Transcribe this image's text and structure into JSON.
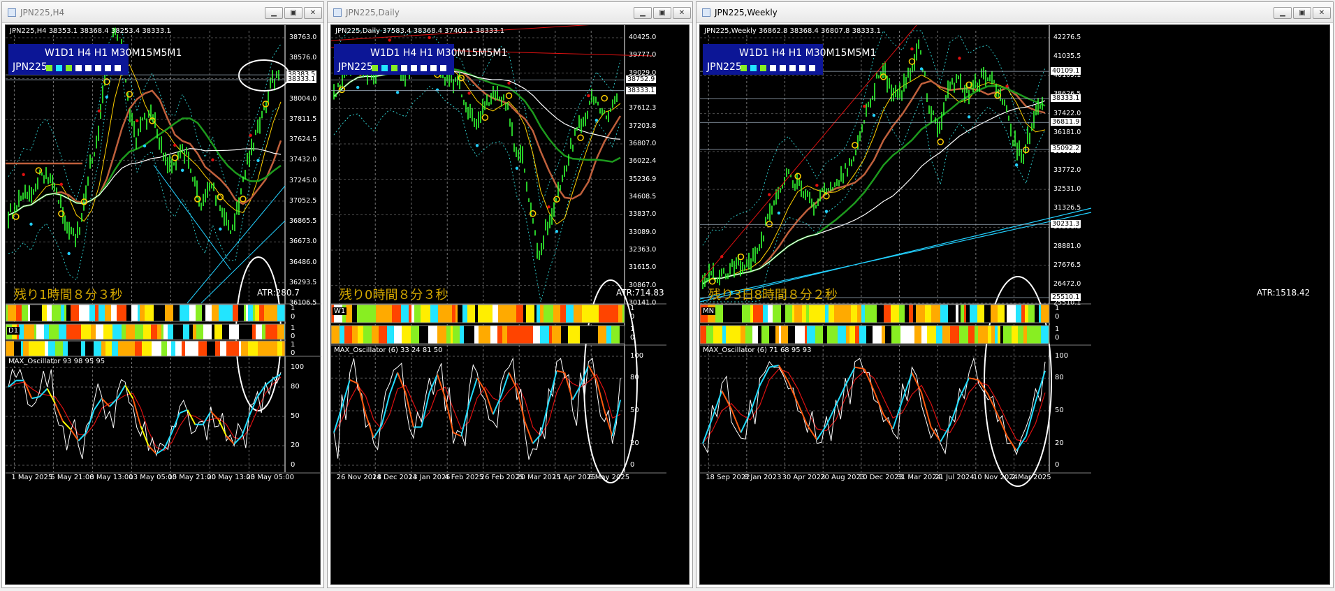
{
  "colors": {
    "candle": "#33ff33",
    "ma_white": "#ffffff",
    "ma_brown": "#c0603c",
    "ma_green": "#1d9a1d",
    "ma_yellow": "#ffd000",
    "band_cyan": "#2ec9c9",
    "trend_cyan": "#22d0ff",
    "trend_red": "#e01010",
    "osc_white": "#ffffff",
    "osc_red": "#dd1111",
    "osc_orange": "#ff5a10",
    "osc_cyan": "#22ddff",
    "osc_yellow": "#ffff00",
    "bar_white": "#ffffff",
    "bar_cyan": "#22e5ff",
    "bar_green": "#88ee22",
    "bar_red": "#ff4400",
    "bar_orange": "#ffaa00",
    "bar_yellow": "#ffee00"
  },
  "infobox": {
    "timeframes": "W1D1 H4 H1 M30M15M5M1",
    "symbol": "JPN225",
    "dot_colors": [
      "#88ee22",
      "#22e5ff",
      "#88ee22",
      "#ffffff",
      "#ffffff",
      "#ffffff",
      "#ffffff",
      "#ffffff"
    ]
  },
  "windows": [
    {
      "title": "JPN225,H4",
      "panel_title": "JPN225,H4  38353.1 38368.4 38253.4 38333.1",
      "remaining": "残り1時間８分３秒",
      "atr": "ATR:280.7",
      "oscillator": "MAX_Oscillator 93 98 95 95",
      "strip_labels": [
        "",
        "D1",
        ""
      ],
      "chart_data": {
        "type": "line",
        "title": "",
        "price_ticks": [
          "38763.0",
          "38576.0",
          "38191.0",
          "38004.0",
          "37811.5",
          "37624.5",
          "37432.0",
          "37245.0",
          "37052.5",
          "36865.5",
          "36673.0",
          "36486.0",
          "36293.5",
          "36106.5"
        ],
        "price_tags": [
          "38383.5",
          "38333.1"
        ],
        "x_labels": [
          "1 May 2025",
          "5 May 21:00",
          "8 May 13:00",
          "13 May 05:00",
          "15 May 21:00",
          "20 May 13:00",
          "23 May 05:00"
        ],
        "osc_levels": [
          "100",
          "80",
          "50",
          "20",
          "0"
        ],
        "ylim": [
          36106.5,
          38763.0
        ],
        "series": [
          {
            "values": [
              36950,
              37020,
              37150,
              37100,
              37320,
              37400,
              37250,
              37050,
              36800,
              36700,
              37000,
              37500,
              37800,
              38400,
              38800,
              38650,
              38100,
              37700,
              37900,
              38000,
              37750,
              37500,
              37450,
              37650,
              37500,
              37200,
              37050,
              37300,
              37050,
              36850,
              36800,
              37200,
              37550,
              37750,
              38000,
              38300,
              38380
            ]
          }
        ],
        "osc": [
          {
            "values": [
              80,
              90,
              85,
              60,
              75,
              80,
              55,
              40,
              35,
              20,
              40,
              65,
              70,
              55,
              75,
              85,
              60,
              30,
              15,
              10,
              20,
              40,
              60,
              55,
              35,
              45,
              60,
              40,
              25,
              20,
              35,
              60,
              75,
              85,
              90,
              95
            ]
          }
        ]
      }
    },
    {
      "title": "JPN225,Daily",
      "panel_title": "JPN225,Daily  37583.4 38368.4 37403.1 38333.1",
      "remaining": "残り0時間８分３秒",
      "atr": "ATR:714.83",
      "oscillator": "MAX_Oscillator (6) 33 24 81 50",
      "strip_labels": [
        "W1",
        ""
      ],
      "chart_data": {
        "type": "line",
        "title": "",
        "price_ticks": [
          "40425.0",
          "39777.0",
          "39029.0",
          "38588.5",
          "37612.3",
          "37203.8",
          "36807.0",
          "36022.4",
          "35236.9",
          "34608.5",
          "33837.0",
          "33089.0",
          "32363.0",
          "31615.0",
          "30867.0",
          "30141.0"
        ],
        "price_tags": [
          "38752.9",
          "38333.1"
        ],
        "x_labels": [
          "26 Nov 2024",
          "18 Dec 2024",
          "13 Jan 2025",
          "4 Feb 2025",
          "26 Feb 2025",
          "20 Mar 2025",
          "11 Apr 2025",
          "6 May 2025"
        ],
        "osc_levels": [
          "100",
          "80",
          "50",
          "20",
          "0"
        ],
        "ylim": [
          30141.0,
          40425.0
        ],
        "series": [
          {
            "values": [
              38100,
              38700,
              39200,
              39400,
              39100,
              38800,
              39300,
              39500,
              39200,
              38900,
              39300,
              39400,
              39600,
              39300,
              38900,
              38700,
              38500,
              37400,
              37100,
              37600,
              38000,
              38200,
              37800,
              36200,
              35600,
              33800,
              31800,
              32900,
              33700,
              34700,
              35900,
              36800,
              37300,
              38100,
              37700,
              37200,
              38300
            ]
          }
        ],
        "osc": [
          {
            "values": [
              30,
              65,
              85,
              70,
              35,
              20,
              45,
              75,
              90,
              55,
              25,
              40,
              80,
              85,
              50,
              20,
              30,
              70,
              85,
              60,
              40,
              75,
              90,
              60,
              30,
              15,
              35,
              70,
              95,
              80,
              50,
              85,
              95,
              70,
              40,
              20,
              80
            ]
          }
        ]
      }
    },
    {
      "title": "JPN225,Weekly",
      "panel_title": "JPN225,Weekly  36862.8 38368.4 36807.8 38333.1",
      "remaining": "残り3日8時間８分２秒",
      "atr": "ATR:1518.42",
      "oscillator": "MAX_Oscillator (6) 71 68 95 93",
      "strip_labels": [
        "MN",
        ""
      ],
      "chart_data": {
        "type": "line",
        "title": "",
        "price_ticks": [
          "42276.5",
          "41035.5",
          "40109.1",
          "38626.5",
          "37422.0",
          "36181.0",
          "35092.2",
          "33772.0",
          "32531.0",
          "31326.5",
          "30231.3",
          "28881.0",
          "27676.5",
          "26472.0",
          "25510.1"
        ],
        "price_tags": [
          "40109.1",
          "38333.1",
          "36811.9",
          "35092.2",
          "30231.3",
          "25510.1"
        ],
        "x_labels": [
          "18 Sep 2022",
          "8 Jan 2023",
          "30 Apr 2023",
          "20 Aug 2023",
          "10 Dec 2023",
          "31 Mar 2024",
          "21 Jul 2024",
          "10 Nov 2024",
          "2 Mar 2025"
        ],
        "osc_levels": [
          "100",
          "80",
          "50",
          "20",
          "0"
        ],
        "ylim": [
          25510.1,
          42276.5
        ],
        "series": [
          {
            "values": [
              26400,
              27100,
              26800,
              27400,
              27600,
              27800,
              28600,
              30800,
              32500,
              33300,
              32800,
              32300,
              31400,
              32600,
              33000,
              33600,
              34800,
              36500,
              38800,
              40300,
              39100,
              38400,
              40200,
              41800,
              37800,
              36100,
              38900,
              39600,
              38700,
              39400,
              39800,
              39100,
              37800,
              35600,
              34500,
              36900,
              38333
            ]
          }
        ],
        "osc": [
          {
            "values": [
              20,
              55,
              75,
              40,
              25,
              60,
              80,
              95,
              90,
              70,
              50,
              30,
              20,
              45,
              60,
              80,
              95,
              85,
              60,
              40,
              30,
              75,
              90,
              55,
              25,
              20,
              45,
              70,
              85,
              75,
              60,
              40,
              20,
              10,
              35,
              70,
              95
            ]
          }
        ]
      }
    }
  ]
}
